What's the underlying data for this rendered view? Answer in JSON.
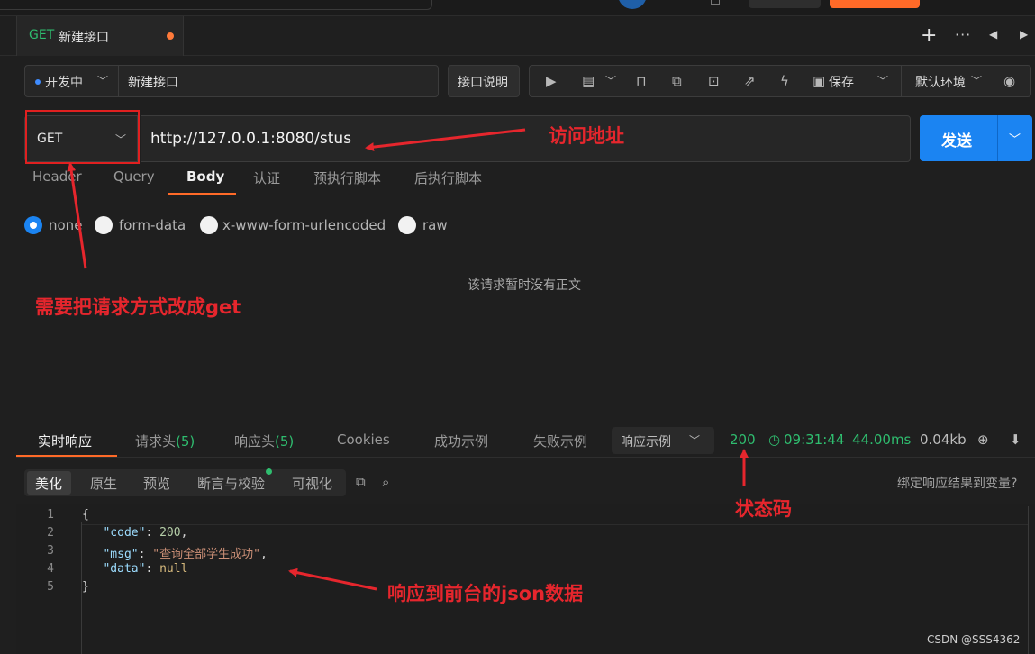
{
  "tab": {
    "method": "GET",
    "name": "新建接口"
  },
  "toolbar": {
    "status": "开发中",
    "api_name": "新建接口",
    "doc_button": "接口说明",
    "save_label": "保存",
    "environment": "默认环境"
  },
  "request": {
    "method": "GET",
    "url": "http://127.0.0.1:8080/stus",
    "send_label": "发送",
    "tabs": [
      "Header",
      "Query",
      "Body",
      "认证",
      "预执行脚本",
      "后执行脚本"
    ],
    "active_tab": "Body",
    "body_types": [
      "none",
      "form-data",
      "x-www-form-urlencoded",
      "raw"
    ],
    "selected_body_type": "none",
    "empty_body_text": "该请求暂时没有正文"
  },
  "response": {
    "tabs": {
      "realtime": "实时响应",
      "req_headers": "请求头",
      "req_headers_count": "(5)",
      "resp_headers": "响应头",
      "resp_headers_count": "(5)",
      "cookies": "Cookies",
      "success_example": "成功示例",
      "fail_example": "失败示例"
    },
    "example_select": "响应示例",
    "status_code": "200",
    "time": "09:31:44",
    "duration": "44.00ms",
    "size": "0.04kb",
    "format_tabs": [
      "美化",
      "原生",
      "预览",
      "断言与校验",
      "可视化"
    ],
    "active_format": "美化",
    "bind_text": "绑定响应结果到变量?",
    "code_lines": {
      "l1": "{",
      "key_code": "\"code\"",
      "val_code": "200",
      "key_msg": "\"msg\"",
      "val_msg": "\"查询全部学生成功\"",
      "key_data": "\"data\"",
      "val_data": "null",
      "l5": "}"
    },
    "line_numbers": [
      "1",
      "2",
      "3",
      "4",
      "5"
    ]
  },
  "annotations": {
    "url": "访问地址",
    "method": "需要把请求方式改成get",
    "status": "状态码",
    "json": "响应到前台的json数据"
  },
  "watermark": "CSDN @SSS4362",
  "colors": {
    "accent_orange": "#ff6a28",
    "send_blue": "#1b84f2",
    "success_green": "#2fbd6f",
    "annotation_red": "#e6262d"
  }
}
